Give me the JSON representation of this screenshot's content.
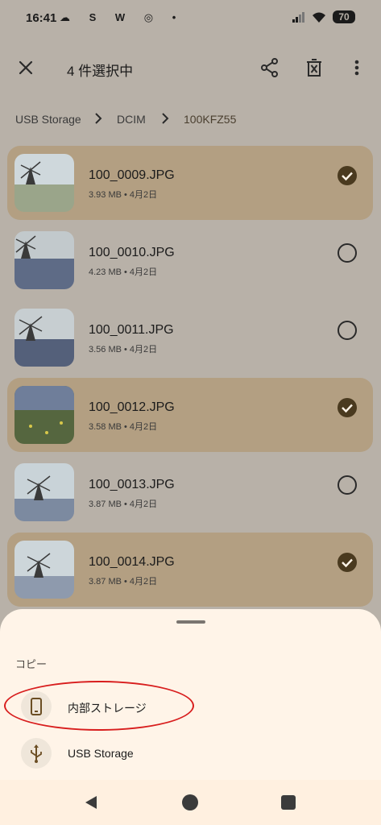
{
  "status_bar": {
    "time": "16:41",
    "left_icons": [
      "cloud-icon",
      "s-icon",
      "w-icon",
      "target-icon",
      "dot-icon"
    ],
    "left_glyphs": "☁ S W ◎ •",
    "battery": "70"
  },
  "toolbar": {
    "close_icon": "close-icon",
    "selection_title": "4 件選択中",
    "share_icon": "share-icon",
    "delete_icon": "delete-icon",
    "more_icon": "more-vert-icon"
  },
  "breadcrumb": {
    "items": [
      "USB Storage",
      "DCIM",
      "100KFZ55"
    ]
  },
  "files": [
    {
      "name": "100_0009.JPG",
      "meta": "3.93 MB • 4月2日",
      "selected": true
    },
    {
      "name": "100_0010.JPG",
      "meta": "4.23 MB • 4月2日",
      "selected": false
    },
    {
      "name": "100_0011.JPG",
      "meta": "3.56 MB • 4月2日",
      "selected": false
    },
    {
      "name": "100_0012.JPG",
      "meta": "3.58 MB • 4月2日",
      "selected": true
    },
    {
      "name": "100_0013.JPG",
      "meta": "3.87 MB • 4月2日",
      "selected": false
    },
    {
      "name": "100_0014.JPG",
      "meta": "3.87 MB • 4月2日",
      "selected": true
    }
  ],
  "sheet": {
    "title": "コピー",
    "destinations": [
      {
        "label": "内部ストレージ",
        "icon": "phone-icon"
      },
      {
        "label": "USB Storage",
        "icon": "usb-icon"
      }
    ]
  },
  "colors": {
    "selected_row": "#b39f82",
    "sheet_bg": "#fff4e8",
    "highlight": "#d81e1e",
    "check_fill": "#4a3a1f"
  }
}
